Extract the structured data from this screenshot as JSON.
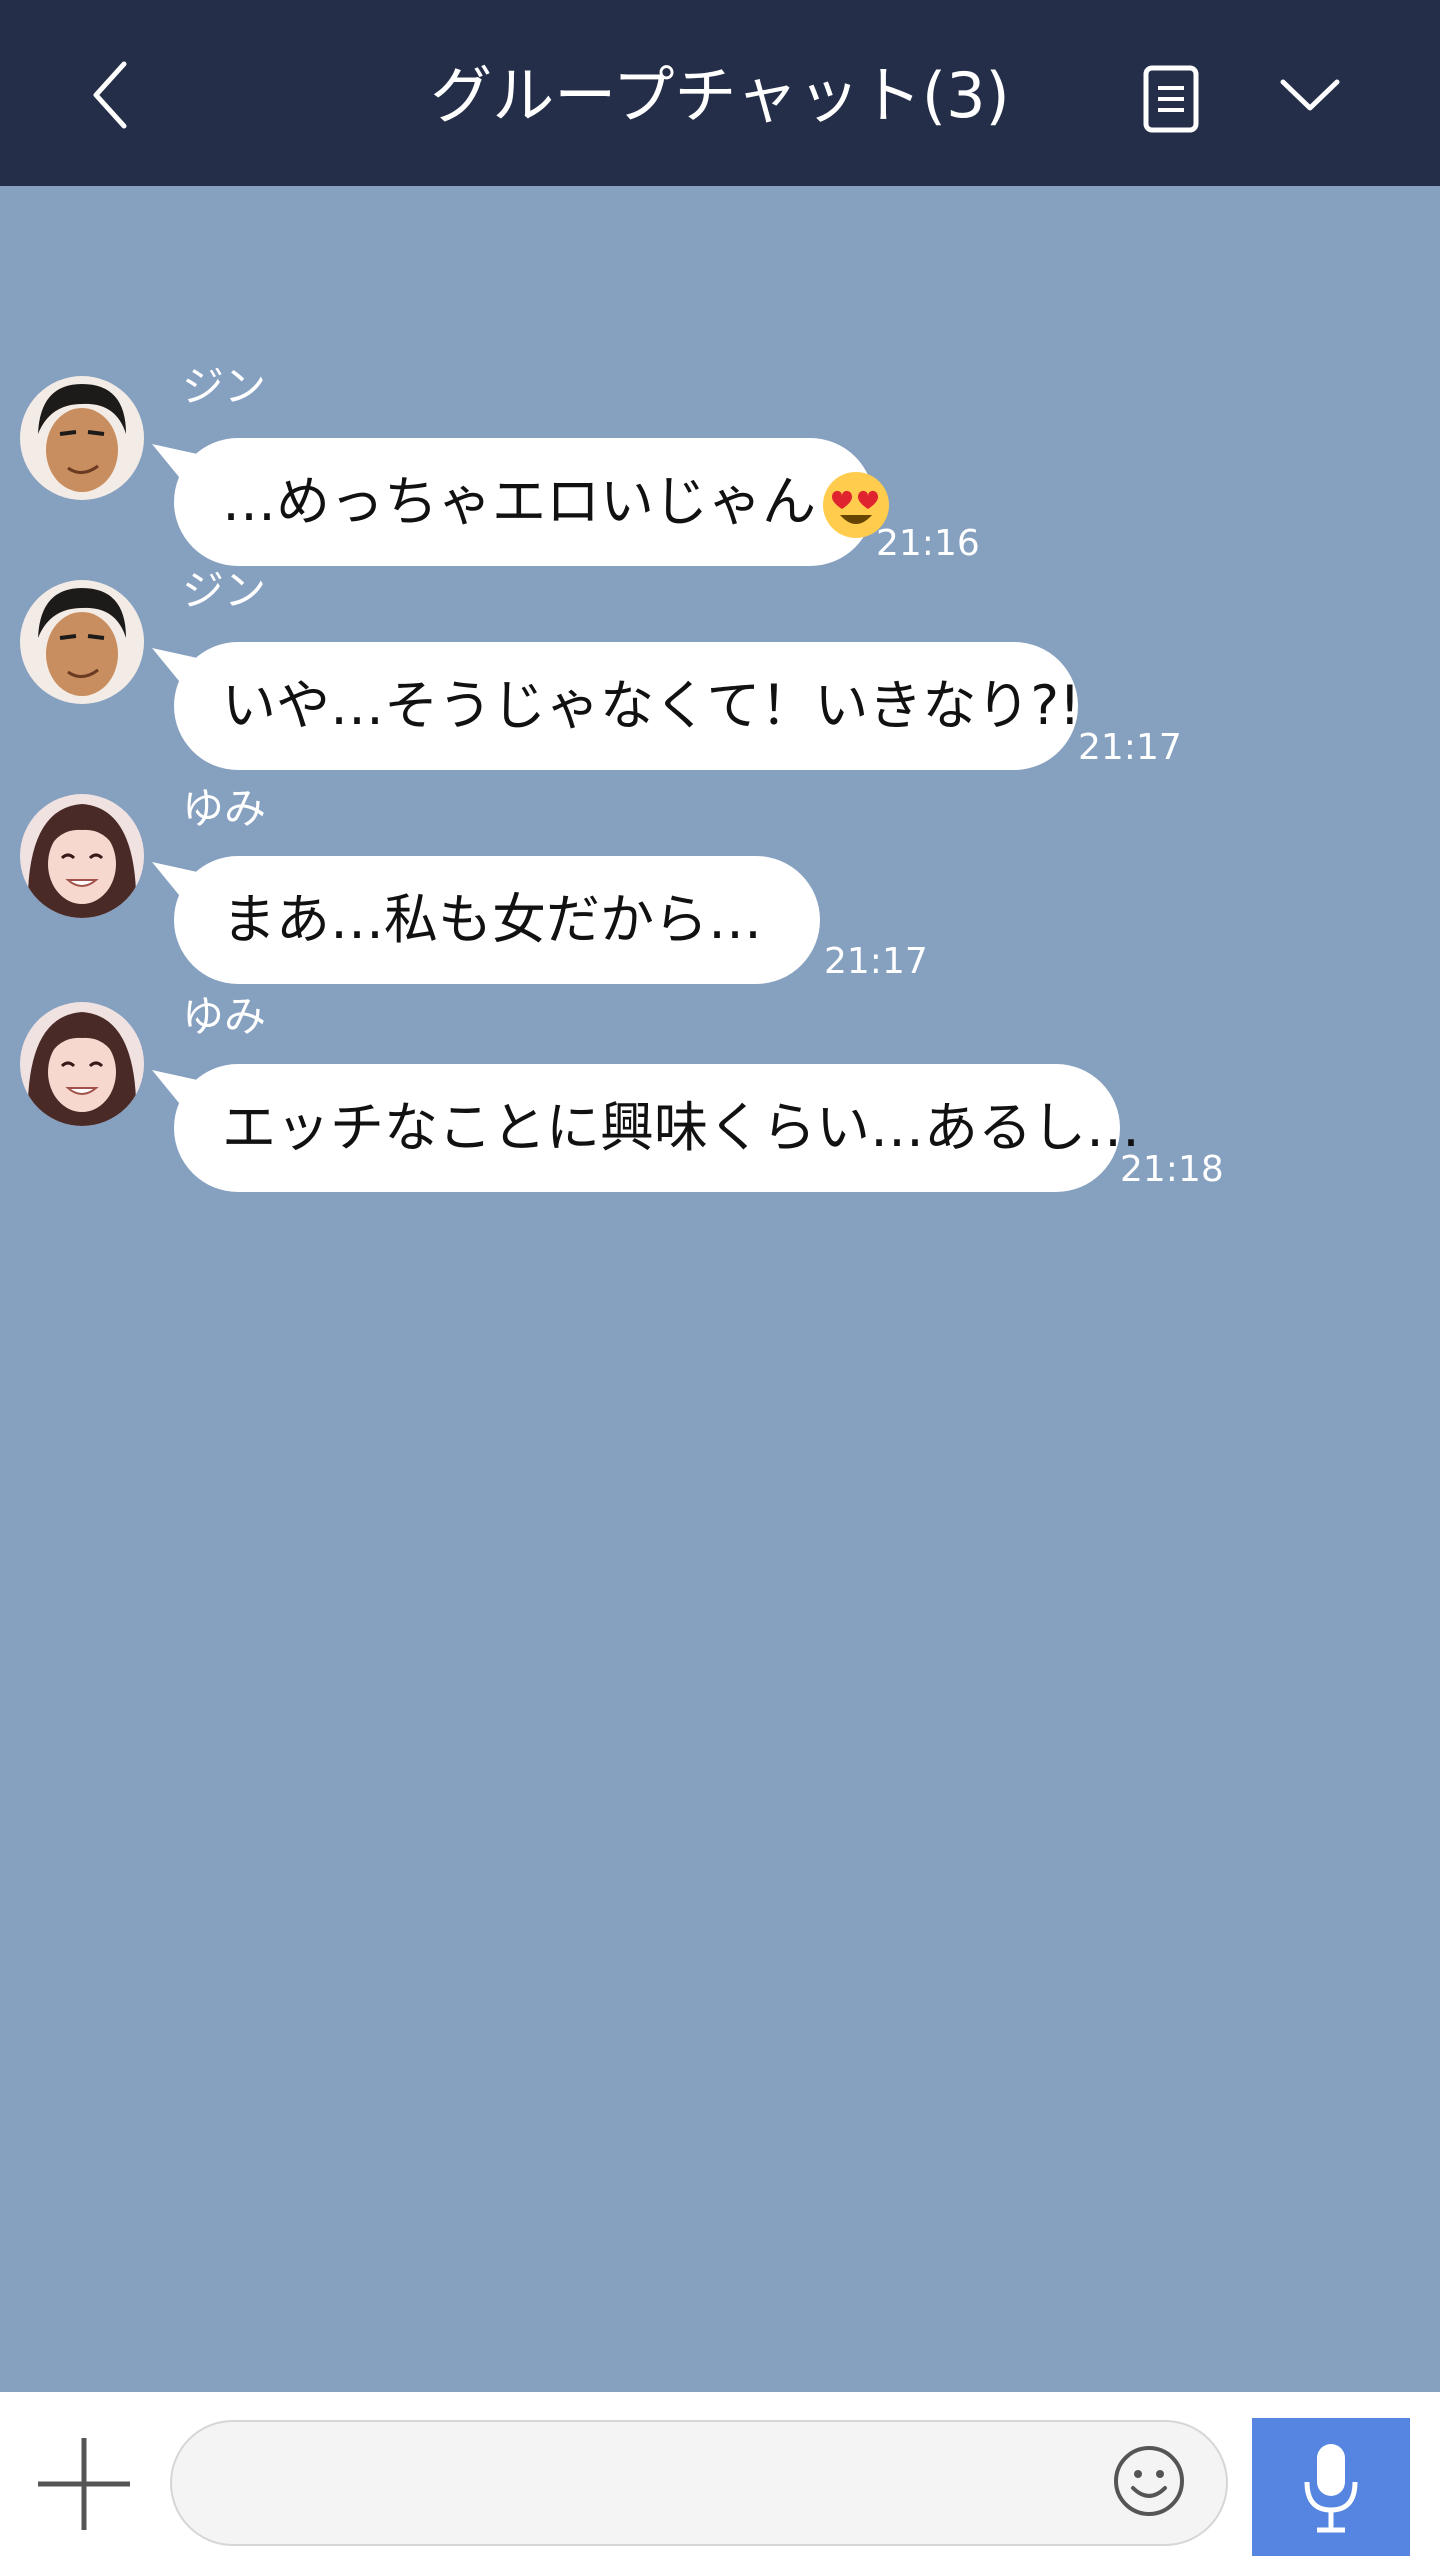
{
  "header": {
    "title": "グループチャット(3)",
    "back_icon": "chevron-left-icon",
    "menu_icon": "document-list-icon",
    "expand_icon": "chevron-down-icon"
  },
  "colors": {
    "header_bg": "#252e48",
    "chat_bg": "#86a0c0",
    "bubble_bg": "#ffffff",
    "send_button_bg": "#5585e0"
  },
  "messages": [
    {
      "sender": "ジン",
      "text": "…めっちゃエロいじゃん",
      "emoji": "heart-eyes-emoji",
      "time": "21:16"
    },
    {
      "sender": "ジン",
      "text": "いや…そうじゃなくて！いきなり?!",
      "time": "21:17"
    },
    {
      "sender": "ゆみ",
      "text": "まあ…私も女だから…",
      "time": "21:17"
    },
    {
      "sender": "ゆみ",
      "text": "エッチなことに興味くらい…あるし…",
      "time": "21:18"
    }
  ],
  "footer": {
    "input_value": "",
    "plus_icon": "plus-icon",
    "emoji_icon": "smiley-icon",
    "mic_icon": "microphone-icon"
  }
}
